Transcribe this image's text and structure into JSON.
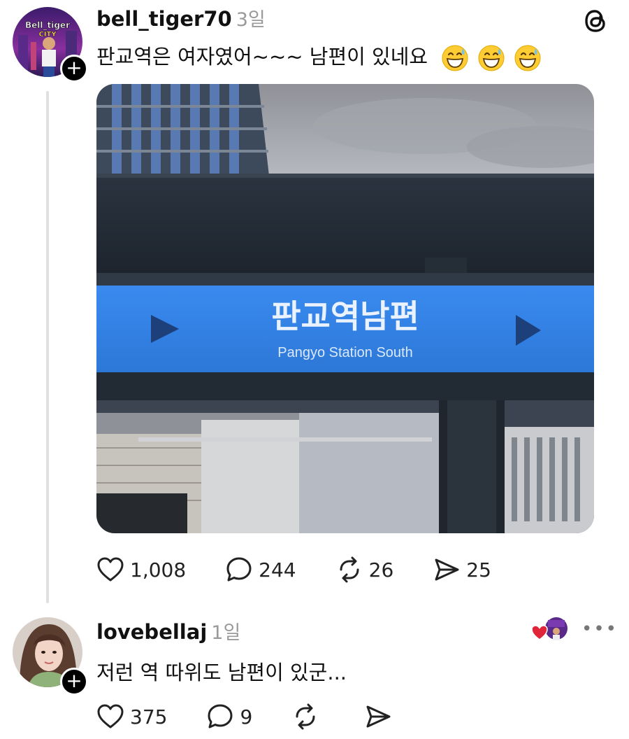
{
  "post": {
    "username": "bell_tiger70",
    "time": "3일",
    "text": "판교역은 여자였어~~~ 남편이 있네요",
    "emojis": [
      "grinning-sweat-emoji",
      "grinning-sweat-emoji",
      "grinning-sweat-emoji"
    ],
    "avatar_text": "Bell_tiger CITY",
    "photo": {
      "sign_korean": "판교역남편",
      "sign_english": "Pangyo Station South"
    },
    "actions": {
      "likes": "1,008",
      "replies": "244",
      "reposts": "26",
      "shares": "25"
    }
  },
  "reply": {
    "username": "lovebellaj",
    "time": "1일",
    "text": "저런 역 따위도 남편이 있군...",
    "more": "•••",
    "actions": {
      "likes": "375",
      "replies": "9"
    }
  },
  "icons": {
    "app_logo": "threads-icon",
    "follow": "plus-icon",
    "like": "heart-icon",
    "reply": "comment-icon",
    "repost": "repost-icon",
    "share": "send-icon"
  },
  "colors": {
    "sign_blue": "#2f7fe3",
    "heart_red": "#e0243a",
    "muted_gray": "#9a9a9a"
  }
}
